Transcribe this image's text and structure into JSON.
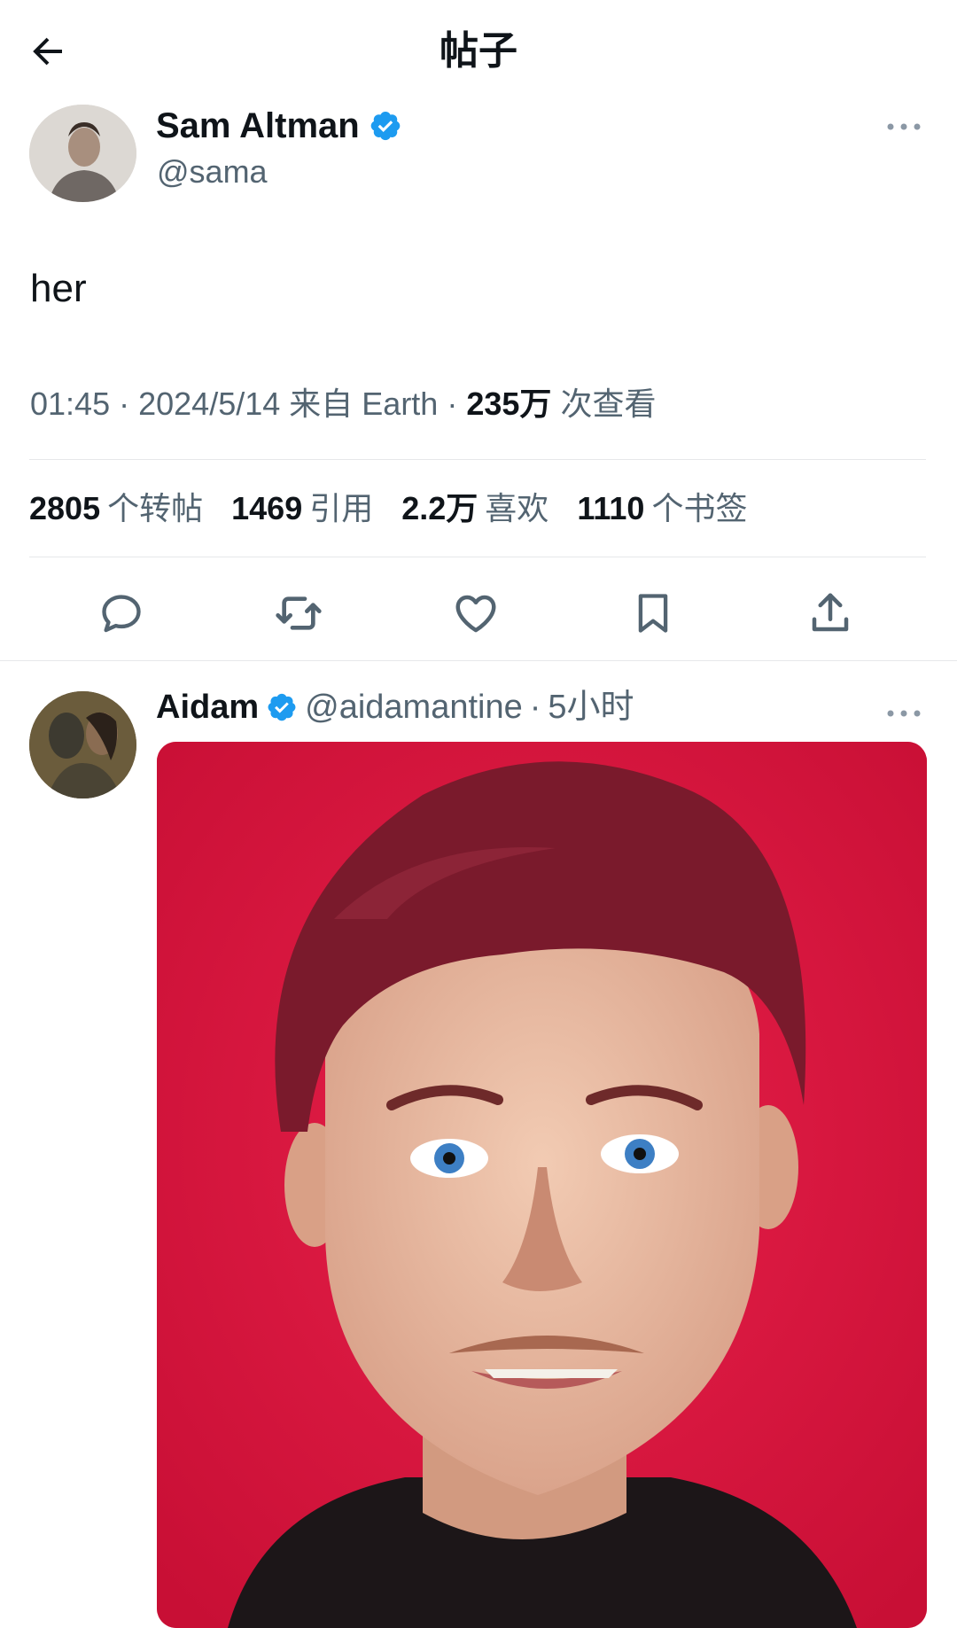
{
  "header": {
    "title": "帖子",
    "back_icon": "arrow-left-icon"
  },
  "tweet": {
    "author_name": "Sam Altman",
    "author_handle": "@sama",
    "text": "her",
    "time": "01:45",
    "date": "2024/5/14",
    "source": "来自 Earth",
    "views_value": "235万",
    "views_label": "次查看",
    "stats": {
      "retweets_value": "2805",
      "retweets_label": "个转帖",
      "quotes_value": "1469",
      "quotes_label": "引用",
      "likes_value": "2.2万",
      "likes_label": "喜欢",
      "bookmarks_value": "1110",
      "bookmarks_label": "个书签"
    },
    "actions": [
      "reply-icon",
      "retweet-icon",
      "like-icon",
      "bookmark-icon",
      "share-icon"
    ]
  },
  "reply": {
    "author_name": "Aidam",
    "author_handle": "@aidamantine",
    "time_ago": "5小时"
  },
  "colors": {
    "verified": "#1d9bf0",
    "secondary_text": "#536471",
    "primary_text": "#0f1419",
    "image_background": "#dc143c"
  }
}
